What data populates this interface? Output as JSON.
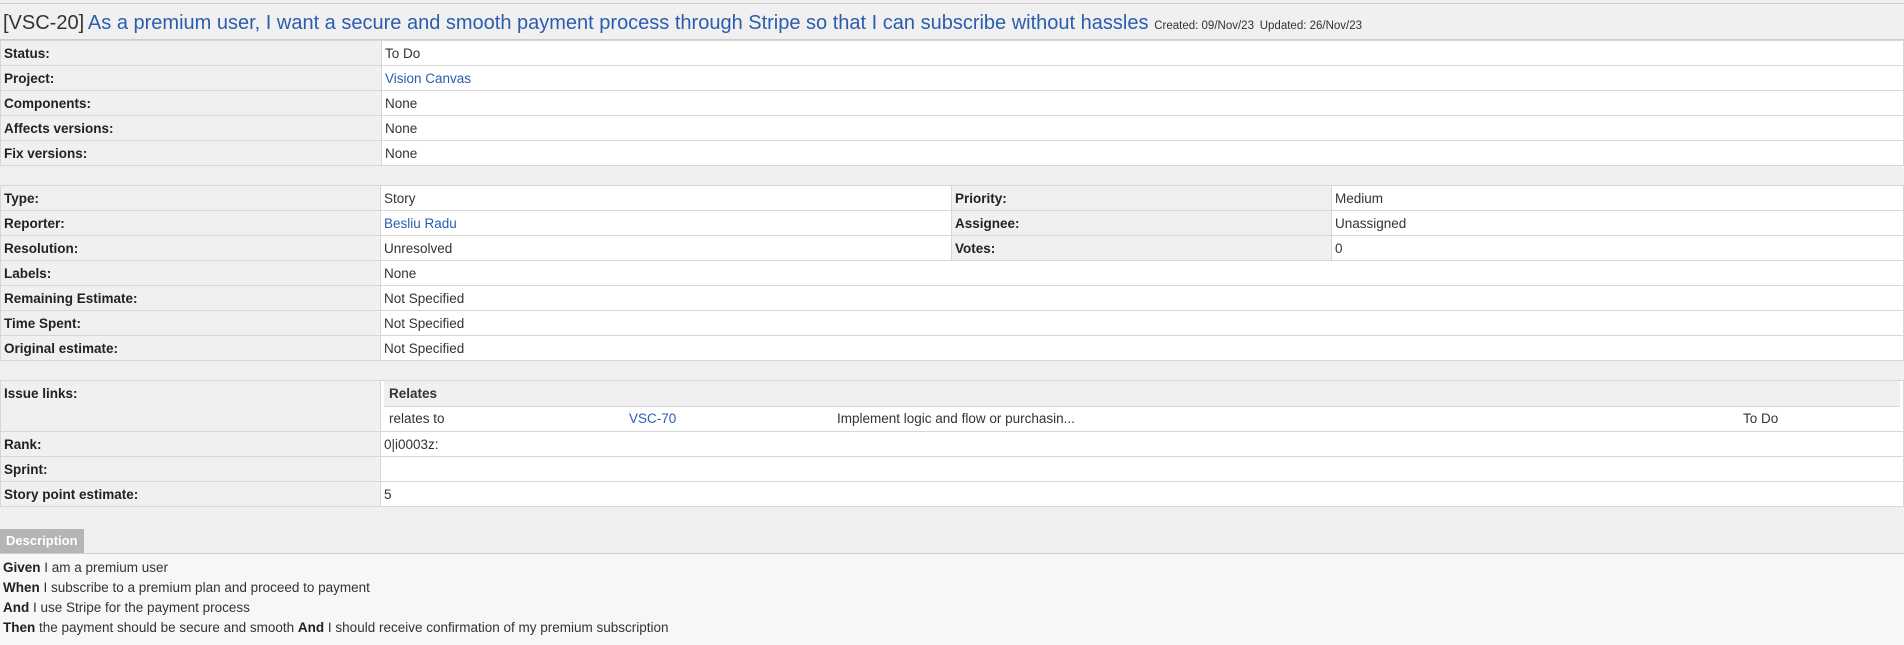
{
  "header": {
    "key": "[VSC-20]",
    "summary": "As a premium user, I want a secure and smooth payment process through Stripe so that I can subscribe without hassles",
    "created": "Created: 09/Nov/23",
    "updated": "Updated: 26/Nov/23"
  },
  "section1": {
    "status_label": "Status:",
    "status": "To Do",
    "project_label": "Project:",
    "project": "Vision Canvas",
    "components_label": "Components:",
    "components": "None",
    "affects_label": "Affects versions:",
    "affects": "None",
    "fix_label": "Fix versions:",
    "fix": "None"
  },
  "section2": {
    "type_label": "Type:",
    "type": "Story",
    "priority_label": "Priority:",
    "priority": "Medium",
    "reporter_label": "Reporter:",
    "reporter": "Besliu Radu",
    "assignee_label": "Assignee:",
    "assignee": "Unassigned",
    "resolution_label": "Resolution:",
    "resolution": "Unresolved",
    "votes_label": "Votes:",
    "votes": "0",
    "labels_label": "Labels:",
    "labels": "None",
    "remaining_label": "Remaining Estimate:",
    "remaining": "Not Specified",
    "timespent_label": "Time Spent:",
    "timespent": "Not Specified",
    "original_label": "Original estimate:",
    "original": "Not Specified"
  },
  "section3": {
    "links_label": "Issue links:",
    "links_group": "Relates",
    "link": {
      "relation": "relates to",
      "key": "VSC-70",
      "summary": "Implement logic and flow or purchasin...",
      "status": "To Do"
    },
    "rank_label": "Rank:",
    "rank": "0|i0003z:",
    "sprint_label": "Sprint:",
    "sprint": "",
    "sp_label": "Story point estimate:",
    "sp": "5"
  },
  "description": {
    "tab": "Description",
    "lines": [
      {
        "kw": "Given",
        "text": " I am a premium user"
      },
      {
        "kw": "When",
        "text": " I subscribe to a premium plan and proceed to payment"
      },
      {
        "kw": "And",
        "text": " I use Stripe for the payment process"
      },
      {
        "kw": "Then",
        "text": " the payment should be secure and smooth ",
        "kw2": "And",
        "text2": " I should receive confirmation of my premium subscription"
      }
    ]
  }
}
